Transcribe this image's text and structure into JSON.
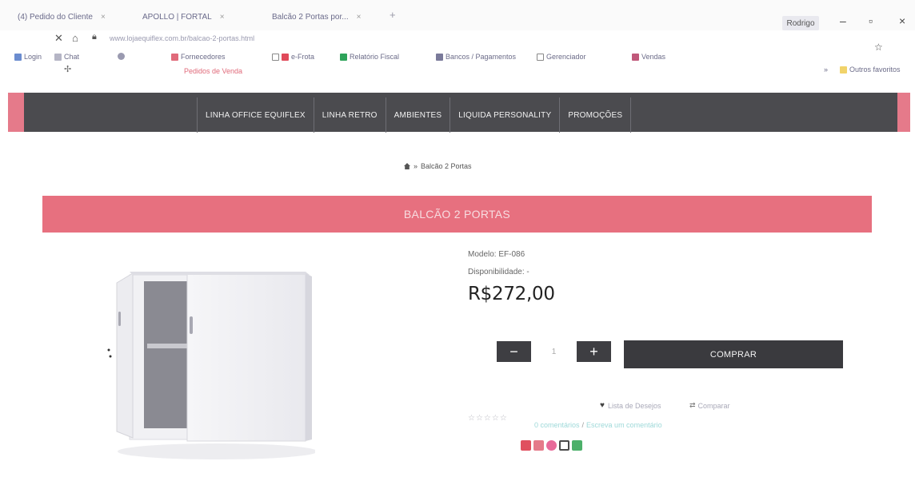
{
  "browser": {
    "tabs": [
      {
        "label": "(4) Pedido do Cliente"
      },
      {
        "label": "APOLLO | FORTAL"
      },
      {
        "label": "Balcão 2 Portas por..."
      }
    ],
    "profile": "Rodrigo",
    "address": "www.lojaequiflex.com.br/balcao-2-portas.html",
    "bookmarks": [
      {
        "label": "Login",
        "color": "#6b8ccf"
      },
      {
        "label": "Chat"
      },
      {
        "label": "Fornecedores",
        "color": "#e06a7a"
      },
      {
        "label": "",
        "color": "#e04a5a"
      },
      {
        "label": "e-Frota",
        "color": "#2ea35a"
      },
      {
        "label": "Relatório Fiscal",
        "color": "#2ea35a"
      },
      {
        "label": "Bancos / Pagamentos",
        "color": "#7a7a9a"
      },
      {
        "label": "Gerenciador",
        "color": "#6b8ccf"
      },
      {
        "label": "Vendas",
        "color": "#c0587a"
      },
      {
        "label": "Outros favoritos",
        "color": "#f1d36a"
      }
    ],
    "bookmark_sub": "Pedidos de Venda"
  },
  "nav": {
    "items": [
      {
        "label": "LINHA OFFICE EQUIFLEX"
      },
      {
        "label": "LINHA RETRO"
      },
      {
        "label": "AMBIENTES"
      },
      {
        "label": "LIQUIDA PERSONALITY"
      },
      {
        "label": "PROMOÇÕES"
      }
    ]
  },
  "breadcrumb": {
    "separator": "»",
    "current": "Balcão 2 Portas"
  },
  "product": {
    "title": "BALCÃO 2 PORTAS",
    "model": "Modelo: EF-086",
    "availability": "Disponibilidade: -",
    "price": "R$272,00",
    "qty": "1",
    "buy_label": "COMPRAR",
    "wishlist": "Lista de Desejos",
    "compare": "Comparar",
    "stars": "☆☆☆☆☆",
    "reviews_count": "0 comentários",
    "write_review": "Escreva um comentário",
    "share_colors": [
      "#e0505f",
      "#e57a8a",
      "#e86a9a",
      "#4a9ad8",
      "#4cb06a"
    ]
  }
}
